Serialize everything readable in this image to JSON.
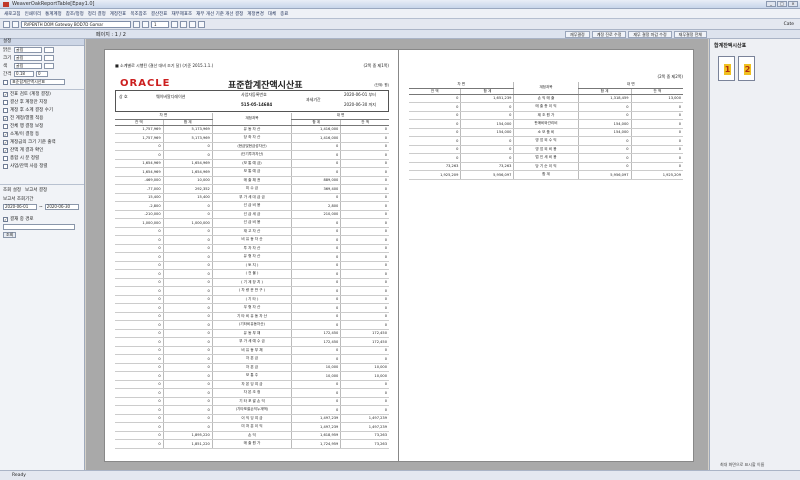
{
  "window": {
    "title": "WeaverOakReportTable[Epay1.0]",
    "buttons": [
      "_",
      "□",
      "×"
    ]
  },
  "menu": [
    "새로고침",
    "인쇄미리",
    "통계계정",
    "참조/정정",
    "정리 결정",
    "계정전표",
    "목조참조",
    "결산전표",
    "재무제표조",
    "재무 개선 기준 개선 결정",
    "계정변경",
    "대체",
    "종료"
  ],
  "toolbar": {
    "printer": "RVPENTH DOM Gateway BOD7D Gamar",
    "zoom": "1",
    "right": "Cate"
  },
  "tabrow": {
    "page_label": "페이지",
    "page_value": "1 / 2",
    "buttons": [
      "재무결정",
      "계정 진로 수정",
      "재무 결정 마감 수정",
      "재무결정 전체"
    ]
  },
  "left_panel": {
    "header": "설정",
    "rows": [
      {
        "label": "맑은",
        "value": "굴림"
      },
      {
        "label": "크기",
        "value": "굴림"
      },
      {
        "label": "색",
        "value": "굴림"
      },
      {
        "label": "간격",
        "value": "0.18",
        "extra": "0"
      }
    ],
    "title_row": "표준합계잔액시산표",
    "checks": [
      {
        "label": "전표 검토 (계정 결정)",
        "on": true
      },
      {
        "label": "결산 후 계정만 지정",
        "on": false
      },
      {
        "label": "계정 후 소계 결정 수기",
        "on": false
      },
      {
        "label": "전 계정/열별 적용",
        "on": true
      },
      {
        "label": "전체 행 결정 보정",
        "on": false
      },
      {
        "label": "소계/이 결정 등",
        "on": true
      },
      {
        "label": "계정금의 크기 기준 출력",
        "on": true
      },
      {
        "label": "잔액 계 결과 확인",
        "on": true
      },
      {
        "label": "총합 시 분 정렬",
        "on": false
      },
      {
        "label": "사업/잔액 사용 정렬",
        "on": false
      }
    ],
    "tabs": [
      "조회 설정",
      "보고서 결정"
    ],
    "period_label": "보고서 조회기간",
    "date_from": "2020-06-01",
    "date_to": "2020-06-30",
    "company_check": "결재 중 경로",
    "query_button": "조회"
  },
  "statement": {
    "pgline": "■ 소계별로 시행된 (결산 대비 조기 달) (기준 2015.1.1.)",
    "page_count": "(2쪽 중 제1쪽)",
    "oracle": "ORACLE",
    "title": "표준합계잔액시산표",
    "unit": "(단위: 원)",
    "company_label": "상 호",
    "company_name": "웨이버알디레이션",
    "regno_label": "사업자등록번호",
    "regno": "515-05-14684",
    "period_label": "과세기간",
    "period_from": "2020-06-01 부터",
    "period_to": "2020-06-30 까지",
    "col_debit": "차 변",
    "col_credit": "대 변",
    "col_account": "계정과목",
    "col_balance": "잔 액",
    "col_total": "합 계",
    "rows": [
      [
        "1,757,969",
        "5,173,969",
        "유 동 자 산",
        "1,416,000",
        "0"
      ],
      [
        "1,757,969",
        "5,173,969",
        "당 좌 자 산",
        "1,416,000",
        "0"
      ],
      [
        "0",
        "0",
        "(현금및현금성자산)",
        "0",
        "0"
      ],
      [
        "0",
        "0",
        "(단기투자자산)",
        "0",
        "0"
      ],
      [
        "1,654,969",
        "1,654,969",
        "(보 통 예 금)",
        "0",
        "0"
      ],
      [
        "1,654,969",
        "1,654,969",
        "보 통 예 금",
        "0",
        "0"
      ],
      [
        "-469,000",
        "10,000",
        "매 출 채 권",
        "889,000",
        "0"
      ],
      [
        "-77,000",
        "292,352",
        "미 수 금",
        "369,400",
        "0"
      ],
      [
        "15,400",
        "15,400",
        "부 가 세 대 급 금",
        "0",
        "0"
      ],
      [
        "-2,800",
        "0",
        "선 급 비 용",
        "2,800",
        "0"
      ],
      [
        "-210,000",
        "0",
        "선 급 세 금",
        "210,000",
        "0"
      ],
      [
        "1,000,000",
        "1,000,000",
        "선 급 비 용",
        "0",
        "0"
      ],
      [
        "0",
        "0",
        "재 고 자 산",
        "0",
        "0"
      ],
      [
        "0",
        "0",
        "비 유 동 자 산",
        "0",
        "0"
      ],
      [
        "0",
        "0",
        "투 자 자 산",
        "0",
        "0"
      ],
      [
        "0",
        "0",
        "유 형 자 산",
        "0",
        "0"
      ],
      [
        "0",
        "0",
        "( 토 지 )",
        "0",
        "0"
      ],
      [
        "0",
        "0",
        "( 건 물 )",
        "0",
        "0"
      ],
      [
        "0",
        "0",
        "( 기 계 장 치 )",
        "0",
        "0"
      ],
      [
        "0",
        "0",
        "( 차 량 운 반 구 )",
        "0",
        "0"
      ],
      [
        "0",
        "0",
        "( 기 타 )",
        "0",
        "0"
      ],
      [
        "0",
        "0",
        "무 형 자 산",
        "0",
        "0"
      ],
      [
        "0",
        "0",
        "기 타 비 유 동 자 산",
        "0",
        "0"
      ],
      [
        "0",
        "0",
        "(기타비유동자산)",
        "0",
        "0"
      ],
      [
        "0",
        "0",
        "유 동 부 채",
        "172,450",
        "172,450"
      ],
      [
        "0",
        "0",
        "부 가 세 예 수 금",
        "172,450",
        "172,450"
      ],
      [
        "0",
        "0",
        "비 유 동 부 채",
        "0",
        "0"
      ],
      [
        "0",
        "0",
        "자 본 금",
        "0",
        "0"
      ],
      [
        "0",
        "0",
        "자 본 금",
        "10,000",
        "10,000"
      ],
      [
        "0",
        "0",
        "보 통 주",
        "10,000",
        "10,000"
      ],
      [
        "0",
        "0",
        "자 본 잉 여 금",
        "0",
        "0"
      ],
      [
        "0",
        "0",
        "자 본 조 정",
        "0",
        "0"
      ],
      [
        "0",
        "0",
        "기 타 포 괄 손 익",
        "0",
        "0"
      ],
      [
        "0",
        "0",
        "(기타포괄손익누계액)",
        "0",
        "0"
      ],
      [
        "0",
        "0",
        "이 익 잉 여 금",
        "1,497,239",
        "1,497,239"
      ],
      [
        "0",
        "0",
        "미 처 분 이 익",
        "1,497,239",
        "1,497,239"
      ],
      [
        "0",
        "1,895,220",
        "손 익",
        "1,618,959",
        "73,263"
      ],
      [
        "0",
        "1,851,220",
        "매 출 원 가",
        "1,724,959",
        "73,263"
      ]
    ]
  },
  "statement2": {
    "page_count": "(2쪽 중 제2쪽)",
    "rows": [
      [
        "0",
        "1,651,239",
        "손 익 매 출",
        "1,318,459",
        "13,000"
      ],
      [
        "0",
        "0",
        "매 출 총 이 익",
        "0",
        "0"
      ],
      [
        "0",
        "0",
        "제 조 원 가",
        "0",
        "0"
      ],
      [
        "0",
        "154,000",
        "판매비와관리비",
        "154,000",
        "0"
      ],
      [
        "0",
        "154,000",
        "소 모 품 비",
        "154,000",
        "0"
      ],
      [
        "0",
        "0",
        "영 업 외 수 익",
        "0",
        "0"
      ],
      [
        "0",
        "0",
        "영 업 외 비 용",
        "0",
        "0"
      ],
      [
        "0",
        "0",
        "법 인 세 비 용",
        "0",
        "0"
      ],
      [
        "73,263",
        "73,263",
        "당 기 순 이 익",
        "0",
        "0"
      ],
      [
        "1,925,209",
        "5,956,097",
        "합 계",
        "5,956,097",
        "1,925,209"
      ]
    ]
  },
  "right_panel": {
    "title": "합계잔액시산표",
    "thumbs": [
      "1",
      "2"
    ],
    "footer": "최대 화면으로 표시할 이름"
  },
  "status": "Ready"
}
